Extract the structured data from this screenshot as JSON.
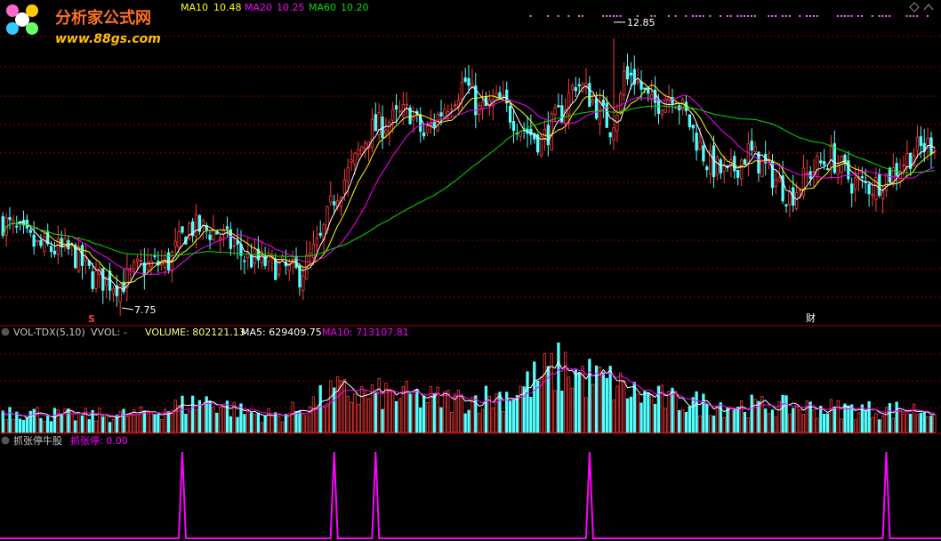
{
  "colors": {
    "up": "#ff3b3b",
    "down": "#54ffff",
    "ma5": "#ffffff",
    "ma10": "#ffff00",
    "ma20": "#ff00ff",
    "ma60": "#00e000",
    "grid": "#8b0000",
    "signal": "#ff00ff",
    "bg": "#000000"
  },
  "logo": {
    "title": "分析家公式网",
    "url": "www.88gs.com"
  },
  "main_panel": {
    "ma_labels": [
      {
        "name": "MA10",
        "value": "10.48",
        "color": "#ffff00"
      },
      {
        "name": "MA20",
        "value": "10.25",
        "color": "#ff00ff"
      },
      {
        "name": "MA60",
        "value": "10.20",
        "color": "#00e000"
      }
    ],
    "high_annotation": "12.85",
    "low_annotation": "7.75",
    "marker_s": "S",
    "marker_cai": "财"
  },
  "volume_panel": {
    "indicator": "VOL-TDX(5,10)",
    "vvol": "VVOL: -",
    "volume": "VOLUME: 802121.13",
    "ma5": "MA5: 629409.75",
    "ma10": "MA10: 713107.81"
  },
  "signal_panel": {
    "name": "抓张停牛股",
    "label": "抓张停: 0.00"
  },
  "chart_data": {
    "type": "candlestick",
    "ylim": [
      7.2,
      13.3
    ],
    "key_prices": {
      "high": 12.85,
      "low": 7.75
    },
    "close_anchors": [
      [
        0,
        9.2
      ],
      [
        10,
        8.7
      ],
      [
        20,
        8.6
      ],
      [
        26,
        8.1
      ],
      [
        34,
        7.95
      ],
      [
        40,
        8.3
      ],
      [
        48,
        8.4
      ],
      [
        54,
        9.1
      ],
      [
        62,
        9.0
      ],
      [
        70,
        8.5
      ],
      [
        80,
        8.3
      ],
      [
        86,
        8.15
      ],
      [
        92,
        8.8
      ],
      [
        96,
        9.7
      ],
      [
        102,
        10.4
      ],
      [
        106,
        11.0
      ],
      [
        112,
        11.2
      ],
      [
        118,
        11.4
      ],
      [
        122,
        10.9
      ],
      [
        128,
        11.5
      ],
      [
        134,
        12.0
      ],
      [
        138,
        11.4
      ],
      [
        144,
        11.6
      ],
      [
        150,
        11.1
      ],
      [
        156,
        10.8
      ],
      [
        162,
        11.4
      ],
      [
        166,
        12.0
      ],
      [
        170,
        11.7
      ],
      [
        176,
        11.1
      ],
      [
        182,
        12.2
      ],
      [
        188,
        11.5
      ],
      [
        194,
        11.8
      ],
      [
        198,
        11.3
      ],
      [
        204,
        10.4
      ],
      [
        210,
        10.1
      ],
      [
        216,
        10.6
      ],
      [
        222,
        10.2
      ],
      [
        228,
        9.7
      ],
      [
        234,
        10.2
      ],
      [
        240,
        10.5
      ],
      [
        246,
        10.0
      ],
      [
        252,
        9.9
      ],
      [
        258,
        10.2
      ],
      [
        264,
        10.6
      ],
      [
        270,
        10.8
      ]
    ],
    "volume_anchors": [
      [
        0,
        0.25
      ],
      [
        20,
        0.18
      ],
      [
        40,
        0.2
      ],
      [
        52,
        0.3
      ],
      [
        60,
        0.35
      ],
      [
        70,
        0.22
      ],
      [
        80,
        0.18
      ],
      [
        90,
        0.32
      ],
      [
        96,
        0.45
      ],
      [
        104,
        0.42
      ],
      [
        112,
        0.42
      ],
      [
        120,
        0.38
      ],
      [
        132,
        0.36
      ],
      [
        144,
        0.4
      ],
      [
        150,
        0.48
      ],
      [
        156,
        0.62
      ],
      [
        162,
        0.72
      ],
      [
        168,
        0.62
      ],
      [
        176,
        0.55
      ],
      [
        184,
        0.42
      ],
      [
        194,
        0.35
      ],
      [
        210,
        0.3
      ],
      [
        230,
        0.28
      ],
      [
        250,
        0.25
      ],
      [
        270,
        0.25
      ]
    ],
    "signal_positions": [
      52,
      96,
      108,
      170,
      256
    ]
  }
}
